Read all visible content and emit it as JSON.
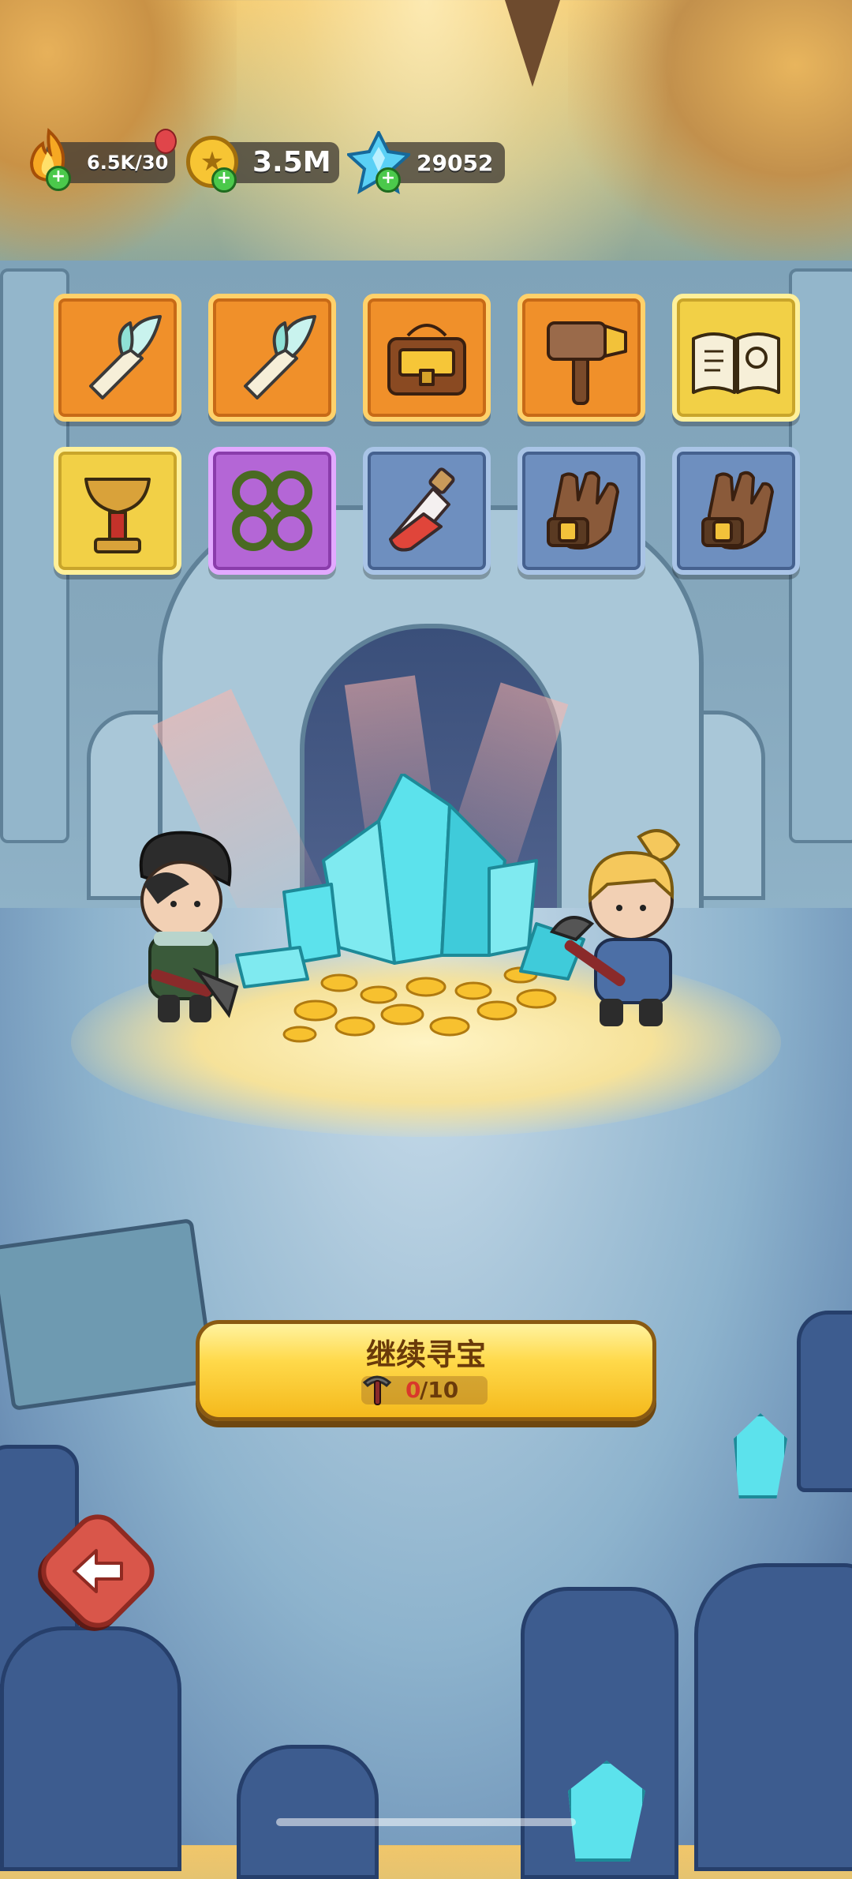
{
  "hud": {
    "energy": {
      "icon": "flame-icon",
      "value": "6.5K/30"
    },
    "coins": {
      "icon": "gold-coin-icon",
      "value": "3.5M"
    },
    "gems": {
      "icon": "blue-crystal-icon",
      "value": "29052"
    }
  },
  "loot_items": [
    {
      "name": "feather-whistle",
      "rarity": "orange"
    },
    {
      "name": "feather-whistle",
      "rarity": "orange"
    },
    {
      "name": "treasure-chest",
      "rarity": "orange"
    },
    {
      "name": "war-hammer",
      "rarity": "orange"
    },
    {
      "name": "spell-book",
      "rarity": "gold"
    },
    {
      "name": "golden-goblet",
      "rarity": "gold"
    },
    {
      "name": "thorn-vines",
      "rarity": "purple"
    },
    {
      "name": "red-potion",
      "rarity": "blue"
    },
    {
      "name": "leather-glove",
      "rarity": "blue"
    },
    {
      "name": "leather-glove",
      "rarity": "blue"
    }
  ],
  "continue_button": {
    "label": "继续寻宝",
    "counter_current": "0",
    "counter_total": "/10",
    "icon": "pickaxe-icon"
  },
  "back_button": {
    "icon": "back-arrow-icon"
  },
  "colors": {
    "orange_tile": "#f0902a",
    "gold_tile": "#f2d046",
    "purple_tile": "#b466d6",
    "blue_tile": "#6e8fbf",
    "button_yellow": "#ffd94a",
    "counter_red": "#d9382b"
  }
}
